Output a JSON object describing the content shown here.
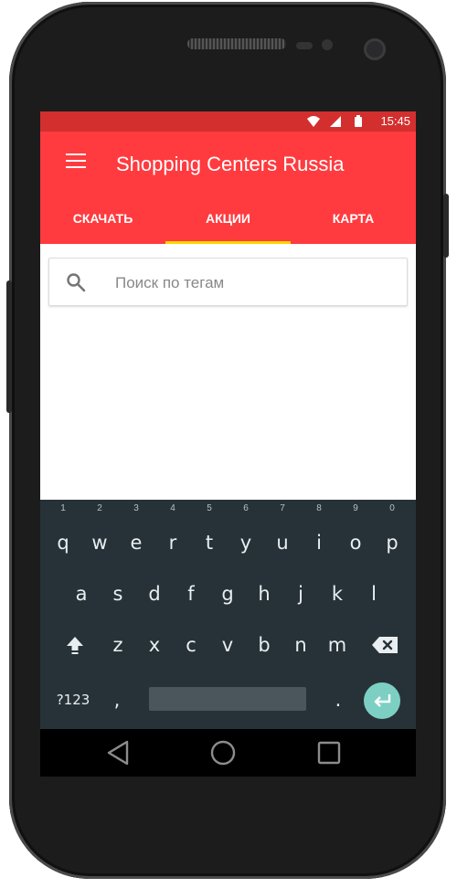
{
  "status_bar": {
    "time": "15:45",
    "icons": [
      "wifi-icon",
      "signal-icon",
      "battery-icon"
    ]
  },
  "app_bar": {
    "title": "Shopping Centers Russia",
    "menu_icon": "menu-icon"
  },
  "tabs": [
    {
      "label": "СКАЧАТЬ",
      "active": false
    },
    {
      "label": "АКЦИИ",
      "active": true
    },
    {
      "label": "КАРТА",
      "active": false
    }
  ],
  "search": {
    "placeholder": "Поиск по тегам",
    "value": ""
  },
  "keyboard": {
    "row1": [
      "q",
      "w",
      "e",
      "r",
      "t",
      "y",
      "u",
      "i",
      "o",
      "p"
    ],
    "row1_hints": [
      "1",
      "2",
      "3",
      "4",
      "5",
      "6",
      "7",
      "8",
      "9",
      "0"
    ],
    "row2": [
      "a",
      "s",
      "d",
      "f",
      "g",
      "h",
      "j",
      "k",
      "l"
    ],
    "row3": [
      "z",
      "x",
      "c",
      "v",
      "b",
      "n",
      "m"
    ],
    "symbols_label": "?123",
    "comma": ",",
    "period": "."
  },
  "colors": {
    "status_bar": "#d32f2f",
    "app_bar": "#ff3b3f",
    "tab_indicator": "#ffd600",
    "keyboard_bg": "#263238",
    "enter_button": "#7dcfc4"
  }
}
